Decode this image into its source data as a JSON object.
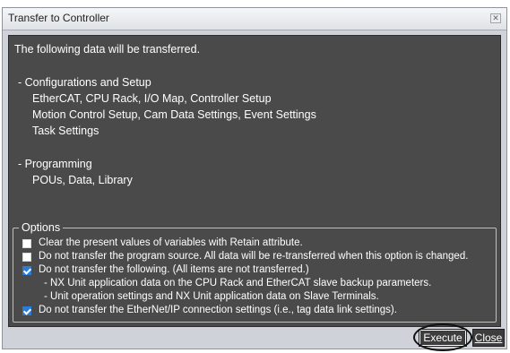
{
  "window": {
    "title": "Transfer to Controller"
  },
  "main": {
    "intro": "The following data will be transferred.",
    "sections": [
      {
        "heading": "- Configurations and Setup",
        "lines": [
          "EtherCAT, CPU Rack, I/O Map, Controller Setup",
          "Motion Control Setup, Cam Data Settings, Event Settings",
          "Task Settings"
        ]
      },
      {
        "heading": "- Programming",
        "lines": [
          "POUs, Data, Library"
        ]
      }
    ]
  },
  "options": {
    "legend": "Options",
    "items": [
      {
        "label": "Clear the present values of variables with Retain attribute.",
        "checked": false
      },
      {
        "label": "Do not transfer the program source. All data will be re-transferred when this option is changed.",
        "checked": false
      },
      {
        "label": "Do not transfer the following. (All items are not transferred.)",
        "checked": true,
        "sub": [
          "- NX Unit application data on the CPU Rack and EtherCAT slave backup parameters.",
          "- Unit operation settings and NX Unit application data on Slave Terminals."
        ]
      },
      {
        "label": "Do not transfer the EtherNet/IP connection settings (i.e., tag data link settings).",
        "checked": true
      }
    ]
  },
  "buttons": {
    "execute": "Execute",
    "close": "Close"
  },
  "colors": {
    "panel": "#4a4a4a",
    "checkbox_checked": "#2b7bd8",
    "dialog": "#cfd3d9"
  }
}
